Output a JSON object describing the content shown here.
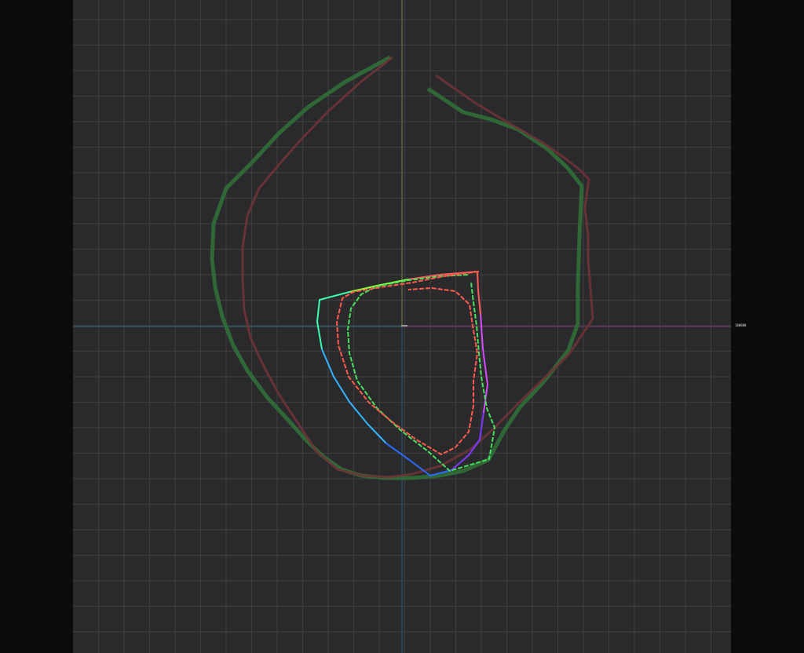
{
  "viewport": {
    "type": "color-gamut-plot",
    "background_color": "#0b0b0b",
    "plot_background_color": "#2a2a2d",
    "grid_color": "#3d3d40",
    "grid": true,
    "axes": {
      "vertical_color": "#6b6a3b",
      "vertical_lower_color": "#2f4d6d",
      "horizontal_left_color": "#2f5f6a",
      "horizontal_right_color": "#6a3a67"
    },
    "axis_readout": "100000",
    "origin_marker_color": "#9a9a9a"
  },
  "outlines": [
    {
      "name": "outer-green-outline",
      "color": "#2f6b37"
    },
    {
      "name": "outer-red-outline",
      "color": "#6e3336"
    },
    {
      "name": "inner-rainbow-outline",
      "colors": [
        "#ff5a5a",
        "#8cff3c",
        "#3cffae",
        "#32b4ff",
        "#2a6cff",
        "#7c39ff",
        "#d64cff"
      ]
    },
    {
      "name": "inner-green-outline",
      "color": "#47e05c"
    },
    {
      "name": "inner-red-outline",
      "color": "#ff5a4a"
    }
  ]
}
